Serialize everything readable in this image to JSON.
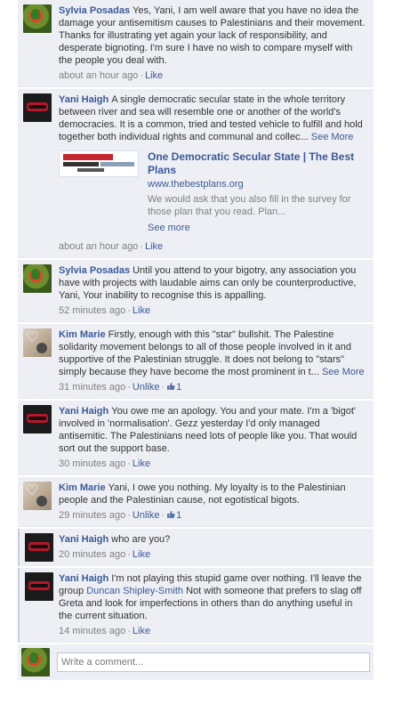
{
  "comments": [
    {
      "author": "Sylvia Posadas",
      "text": "Yes, Yani, I am well aware that you have no idea the damage your antisemitism causes to Palestinians and their movement. Thanks for illustrating yet again your lack of responsibility, and desperate bignoting. I'm sure I have no wish to compare myself with the people you deal with.",
      "time": "about an hour ago",
      "like": "Like"
    },
    {
      "author": "Yani Haigh",
      "text": "A single democratic secular state in the whole territory between river and sea will resemble one or another of the world's democracies. It is a common, tried and tested vehicle to fulfill and hold together both individual rights and communal and collec...",
      "see_more": "See More",
      "attachment": {
        "title": "One Democratic Secular State | The Best Plans",
        "url": "www.thebestplans.org",
        "description": "We would ask that you also fill in the survey for those plan that you read. Plan...",
        "see_more": "See more"
      },
      "time": "about an hour ago",
      "like": "Like"
    },
    {
      "author": "Sylvia Posadas",
      "text": "Until you attend to your bigotry, any association you have with projects with laudable aims can only be counterproductive, Yani, Your inability to recognise this is appalling.",
      "time": "52 minutes ago",
      "like": "Like"
    },
    {
      "author": "Kim Marie",
      "text": "Firstly, enough with this \"star\" bullshit. The Palestine solidarity movement belongs to all of those people involved in it and supportive of the Palestinian struggle. It does not belong to \"stars\" simply because they have become the most prominent in t...",
      "see_more": "See More",
      "time": "31 minutes ago",
      "unlike": "Unlike",
      "likes": "1"
    },
    {
      "author": "Yani Haigh",
      "text": "You owe me an apology. You and your mate. I'm a 'bigot' involved in 'normalisation'. Gezz yesterday I'd only managed antisemitic. The Palestinians need lots of people like you. That would sort out the support base.",
      "time": "30 minutes ago",
      "like": "Like"
    },
    {
      "author": "Kim Marie",
      "text": "Yani, I owe you nothing. My loyalty is to the Palestinian people and the Palestinian cause, not egotistical bigots.",
      "time": "29 minutes ago",
      "unlike": "Unlike",
      "likes": "1"
    },
    {
      "author": "Yani Haigh",
      "text": "who are you?",
      "time": "20 minutes ago",
      "like": "Like"
    },
    {
      "author": "Yani Haigh",
      "text_before": "I'm not playing this stupid game over nothing. I'll leave the group",
      "mention": "Duncan Shipley-Smith",
      "text_after": "Not with someone that prefers to slag off Greta and look for imperfections in others than do anything useful in the current situation.",
      "time": "14 minutes ago",
      "like": "Like"
    }
  ],
  "composer": {
    "placeholder": "Write a comment..."
  },
  "icons": {
    "like_thumb": "thumbs-up-icon"
  },
  "colors": {
    "link": "#3b5998",
    "background": "#edeff4",
    "meta": "#808080"
  }
}
